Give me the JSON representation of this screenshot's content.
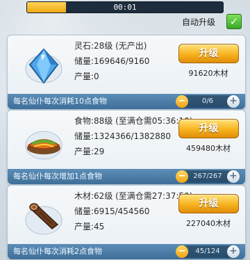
{
  "timer": {
    "text": "00:01",
    "progress_fraction": 0.2
  },
  "auto_upgrade": {
    "label": "自动升级",
    "checked": true
  },
  "cards": [
    {
      "name_line": "灵石:28级 (无产出)",
      "storage": "储量:169646/9160",
      "output": "产量:0",
      "button_label": "升级",
      "cost": "91620木材",
      "footer_text": "每名仙仆每次消耗10点食物",
      "stepper_value": "0/6",
      "icon": "crystal-icon"
    },
    {
      "name_line": "食物:88级 (至满仓需05:36:10)",
      "storage": "储量:1324366/1382880",
      "output": "产量:29",
      "button_label": "升级",
      "cost": "459480木材",
      "footer_text": "每名仙仆每次增加1点食物",
      "stepper_value": "267/267",
      "icon": "food-icon"
    },
    {
      "name_line": "木材:62级 (至满仓需27:37:50)",
      "storage": "储量:6915/454560",
      "output": "产量:45",
      "button_label": "升级",
      "cost": "227040木材",
      "footer_text": "每名仙仆每次消耗2点食物",
      "stepper_value": "45/124",
      "icon": "wood-log-icon"
    }
  ]
}
